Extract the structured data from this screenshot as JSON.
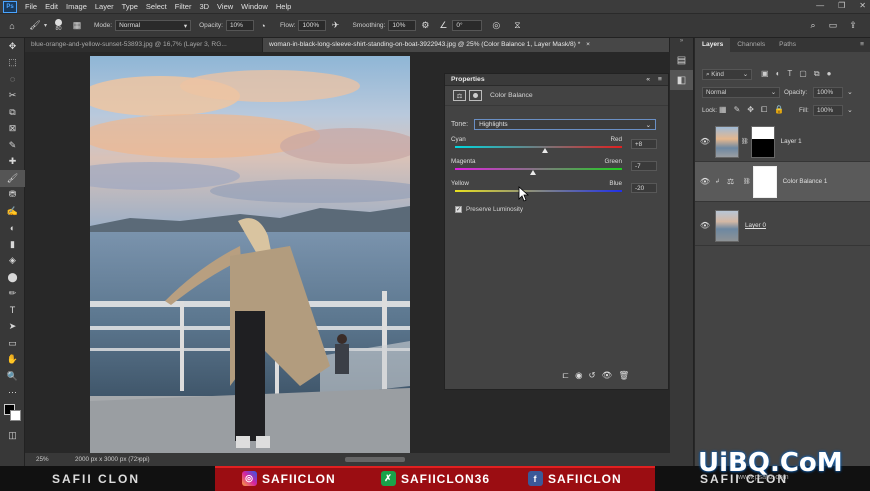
{
  "menubar": {
    "logo": "Ps",
    "items": [
      "File",
      "Edit",
      "Image",
      "Layer",
      "Type",
      "Select",
      "Filter",
      "3D",
      "View",
      "Window",
      "Help"
    ],
    "window_controls": [
      "—",
      "❐",
      "✕"
    ]
  },
  "options": {
    "brush_size": "80",
    "mode_label": "Mode:",
    "mode_value": "Normal",
    "opacity_label": "Opacity:",
    "opacity_value": "10%",
    "flow_label": "Flow:",
    "flow_value": "100%",
    "smoothing_label": "Smoothing:",
    "smoothing_value": "10%",
    "angle_value": "0°"
  },
  "tools": [
    "✥",
    "⬚",
    "◌",
    "✂",
    "⧉",
    "⊠",
    "✎",
    "✚",
    "🖌",
    "⛃",
    "✍",
    "◐",
    "▮",
    "◈",
    "⬤",
    "✏",
    "T",
    "➤",
    "▭",
    "✋",
    "🔍",
    "⋯"
  ],
  "tabs": [
    {
      "label": "blue-orange-and-yellow-sunset-53893.jpg @ 16,7% (Layer 3, RG...",
      "close": "×"
    },
    {
      "label": "woman-in-black-long-sleeve-shirt-standing-on-boat-3922943.jpg @ 25% (Color Balance 1, Layer Mask/8) *",
      "close": "×"
    }
  ],
  "status": {
    "zoom": "25%",
    "doc_info": "2000 px x 3000 px (72 ppi)"
  },
  "properties": {
    "title": "Properties",
    "subtitle": "Color Balance",
    "tone_label": "Tone:",
    "tone_value": "Highlights",
    "sliders": [
      {
        "left": "Cyan",
        "right": "Red",
        "value": "+8",
        "level": 0.54,
        "track": "cyan-red"
      },
      {
        "left": "Magenta",
        "right": "Green",
        "value": "-7",
        "level": 0.465,
        "track": "magenta-green"
      },
      {
        "left": "Yellow",
        "right": "Blue",
        "value": "-20",
        "level": 0.4,
        "track": "yellow-blue"
      }
    ],
    "preserve_luminosity": "Preserve Luminosity"
  },
  "layers": {
    "tabs": [
      "Layers",
      "Channels",
      "Paths"
    ],
    "filter_label": "Kind",
    "blend_mode": "Normal",
    "opacity_label": "Opacity:",
    "opacity_value": "100%",
    "lock_label": "Lock:",
    "fill_label": "Fill:",
    "fill_value": "100%",
    "items": [
      {
        "name": "Layer 1",
        "selected": false
      },
      {
        "name": "Color Balance 1",
        "selected": true
      },
      {
        "name": "Layer 0",
        "selected": false
      }
    ]
  },
  "banner": {
    "left_name": "SAFII CLON",
    "instagram": "SAFIICLON",
    "other": "SAFIICLON36",
    "facebook": "SAFIICLON",
    "right_name": "SAFII CLON"
  },
  "watermark": {
    "logo": "UiBQ.CoM",
    "sub": "www.psahz.com"
  },
  "colors": {
    "accent": "#4aa4ff",
    "banner_red": "#9b0d12"
  }
}
